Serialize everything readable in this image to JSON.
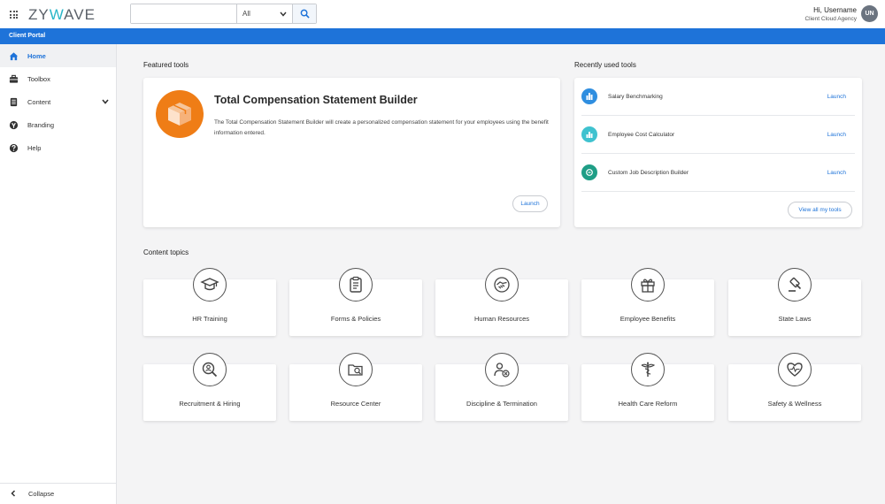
{
  "header": {
    "logo_prefix": "ZY",
    "logo_accent": "W",
    "logo_suffix": "AVE",
    "search_value": "",
    "search_scope": "All",
    "greeting": "Hi, Username",
    "agency": "Client Cloud Agency",
    "avatar_initials": "UN"
  },
  "portal_bar": {
    "label": "Client Portal"
  },
  "sidebar": {
    "items": [
      {
        "label": "Home",
        "icon": "home-icon"
      },
      {
        "label": "Toolbox",
        "icon": "toolbox-icon"
      },
      {
        "label": "Content",
        "icon": "document-icon"
      },
      {
        "label": "Branding",
        "icon": "branding-icon"
      },
      {
        "label": "Help",
        "icon": "help-icon"
      }
    ],
    "collapse_label": "Collapse"
  },
  "featured": {
    "section_title": "Featured tools",
    "title": "Total Compensation Statement Builder",
    "description": "The Total Compensation Statement Builder will create a personalized compensation statement for your employees using the benefit information entered.",
    "launch_label": "Launch"
  },
  "recent": {
    "section_title": "Recently used tools",
    "items": [
      {
        "label": "Salary Benchmarking",
        "launch": "Launch",
        "color": "#2f8ee0"
      },
      {
        "label": "Employee Cost Calculator",
        "launch": "Launch",
        "color": "#3fc2cf"
      },
      {
        "label": "Custom Job Description Builder",
        "launch": "Launch",
        "color": "#1f9e86"
      }
    ],
    "view_all_label": "View all my tools"
  },
  "topics": {
    "section_title": "Content topics",
    "items": [
      {
        "label": "HR Training",
        "icon": "graduation-cap-icon"
      },
      {
        "label": "Forms & Policies",
        "icon": "clipboard-icon"
      },
      {
        "label": "Human Resources",
        "icon": "handshake-icon"
      },
      {
        "label": "Employee Benefits",
        "icon": "gift-icon"
      },
      {
        "label": "State Laws",
        "icon": "gavel-icon"
      },
      {
        "label": "Recruitment & Hiring",
        "icon": "search-person-icon"
      },
      {
        "label": "Resource Center",
        "icon": "folder-search-icon"
      },
      {
        "label": "Discipline & Termination",
        "icon": "person-remove-icon"
      },
      {
        "label": "Health Care Reform",
        "icon": "caduceus-icon"
      },
      {
        "label": "Safety & Wellness",
        "icon": "heart-pulse-icon"
      }
    ]
  },
  "colors": {
    "brand_blue": "#1e73d9",
    "accent_teal": "#29b6c8",
    "featured_orange": "#ef7d16"
  }
}
